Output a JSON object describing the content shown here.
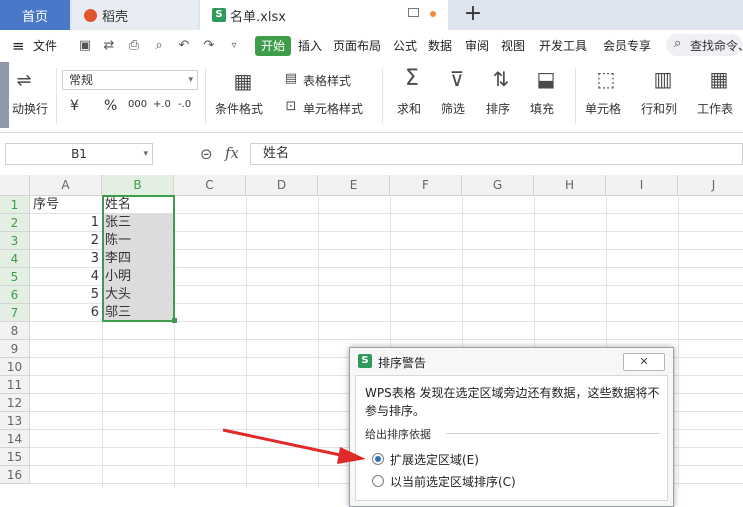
{
  "tabs": {
    "home": "首页",
    "daoke": "稻壳",
    "file": "名单.xlsx",
    "file_badge": "S",
    "add": "+"
  },
  "menu": {
    "hamburger": "≡",
    "file": "文件",
    "items": [
      "开始",
      "插入",
      "页面布局",
      "公式",
      "数据",
      "审阅",
      "视图",
      "开发工具",
      "会员专享"
    ],
    "search": "查找命令、"
  },
  "ribbon": {
    "wrap_partial": "动换行",
    "font_value": "常规",
    "currency": "¥",
    "percent": "%",
    "thousands": "000",
    "dec_inc": "+.0",
    "dec_dec": "-.0",
    "cond_format": "条件格式",
    "table_style": "表格样式",
    "cell_style": "单元格样式",
    "sum": "求和",
    "filter": "筛选",
    "sort": "排序",
    "fill": "填充",
    "cell": "单元格",
    "rowcol": "行和列",
    "sheet": "工作表"
  },
  "formula": {
    "cell_ref": "B1",
    "content": "姓名"
  },
  "grid": {
    "columns": [
      "A",
      "B",
      "C",
      "D",
      "E",
      "F",
      "G",
      "H",
      "I",
      "J"
    ],
    "rows": [
      "1",
      "2",
      "3",
      "4",
      "5",
      "6",
      "7",
      "8",
      "9",
      "10",
      "11",
      "12",
      "13",
      "14",
      "15",
      "16"
    ],
    "a": [
      "序号",
      "1",
      "2",
      "3",
      "4",
      "5",
      "6"
    ],
    "b": [
      "姓名",
      "张三",
      "陈一",
      "李四",
      "小明",
      "大头",
      "邬三"
    ]
  },
  "dialog": {
    "badge": "S",
    "title": "排序警告",
    "message_line1": "WPS表格 发现在选定区域旁边还有数据，这些数据将不",
    "message_line2": "参与排序。",
    "section": "给出排序依据",
    "option1": "扩展选定区域(E)",
    "option2": "以当前选定区域排序(C)",
    "option1_selected": true
  },
  "colors": {
    "accent_green": "#3e9d4a",
    "tab_blue": "#4a78c8",
    "arrow_red": "#e02a2a"
  }
}
